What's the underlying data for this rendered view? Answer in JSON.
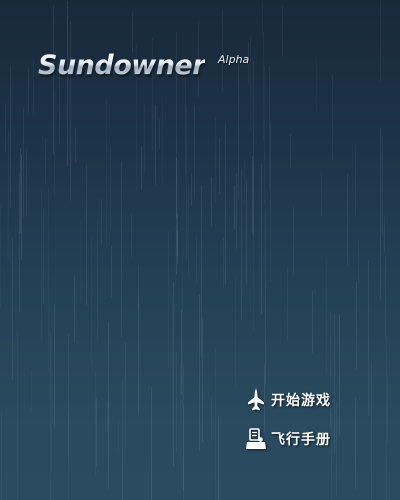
{
  "title": {
    "main": "Sundowner",
    "subtitle": "Alpha"
  },
  "menu": {
    "items": [
      {
        "label": "开始游戏",
        "icon": "fighter-jet-icon"
      },
      {
        "label": "飞行手册",
        "icon": "manual-joystick-icon"
      }
    ]
  },
  "colors": {
    "background_top": "#18293a",
    "background_bottom": "#2a4b60",
    "text": "#ffffff"
  }
}
